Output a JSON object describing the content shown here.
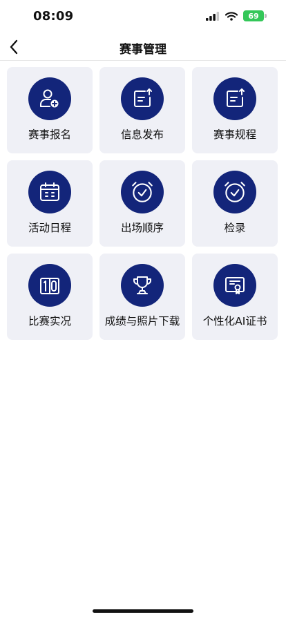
{
  "status_bar": {
    "time": "08:09",
    "battery": "69"
  },
  "nav": {
    "title": "赛事管理",
    "back_icon": "chevron-left-icon"
  },
  "grid": {
    "items": [
      {
        "label": "赛事报名",
        "icon": "user-add-icon"
      },
      {
        "label": "信息发布",
        "icon": "document-upload-icon"
      },
      {
        "label": "赛事规程",
        "icon": "document-upload-icon"
      },
      {
        "label": "活动日程",
        "icon": "calendar-icon"
      },
      {
        "label": "出场顺序",
        "icon": "alarm-clock-check-icon"
      },
      {
        "label": "检录",
        "icon": "alarm-clock-check-icon"
      },
      {
        "label": "比赛实况",
        "icon": "scoreboard-icon"
      },
      {
        "label": "成绩与照片下载",
        "icon": "trophy-icon"
      },
      {
        "label": "个性化AI证书",
        "icon": "certificate-icon"
      }
    ]
  },
  "colors": {
    "icon_bg": "#13257a",
    "tile_bg": "#eff0f6",
    "battery": "#34c759"
  }
}
